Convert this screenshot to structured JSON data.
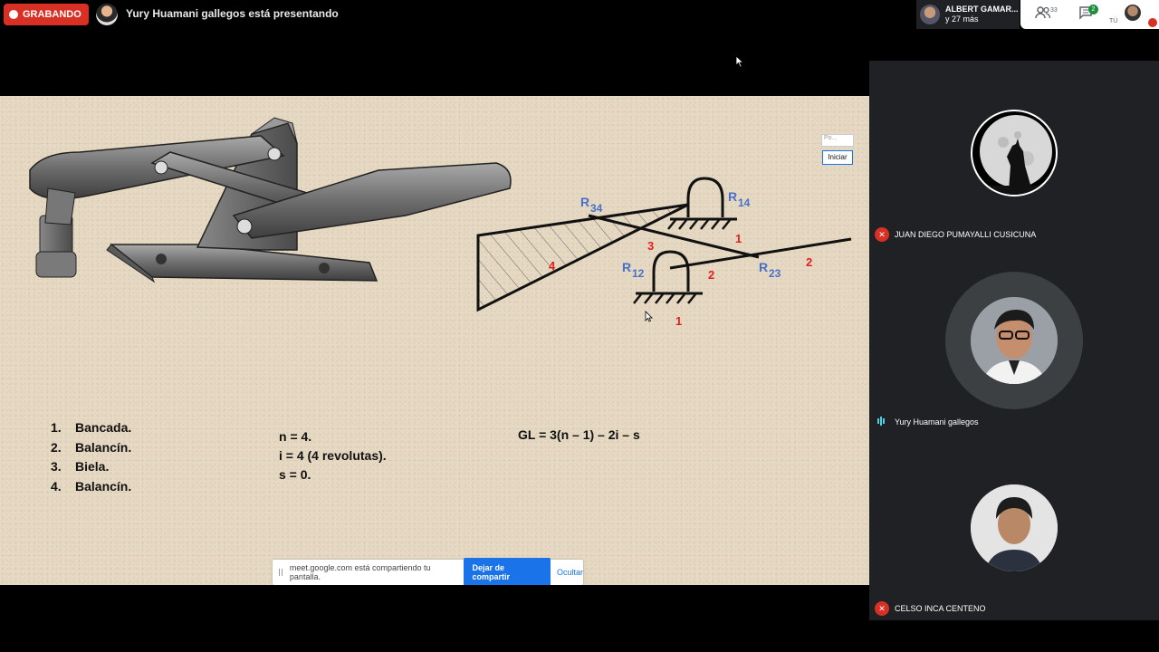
{
  "topbar": {
    "recording_label": "GRABANDO",
    "presenting_text": "Yury Huamani gallegos está presentando",
    "participants_chip": {
      "name": "ALBERT GAMAR...",
      "more": "y 27 más"
    },
    "participants_count": "33",
    "chat_count": "2",
    "self_label": "TÚ"
  },
  "slide": {
    "labels": {
      "r34": "R",
      "r34_sub": "34",
      "r14": "R",
      "r14_sub": "14",
      "r12": "R",
      "r12_sub": "12",
      "r23": "R",
      "r23_sub": "23",
      "n1a": "1",
      "n1b": "1",
      "n2a": "2",
      "n2b": "2",
      "n3": "3",
      "n4": "4"
    },
    "list": [
      {
        "num": "1.",
        "text": "Bancada."
      },
      {
        "num": "2.",
        "text": "Balancín."
      },
      {
        "num": "3.",
        "text": "Biela."
      },
      {
        "num": "4.",
        "text": "Balancín."
      }
    ],
    "params": [
      "n = 4.",
      "i = 4 (4 revolutas).",
      "s = 0."
    ],
    "formula": "GL = 3(n – 1) – 2i – s",
    "mini_placeholder": "Po...",
    "mini_button": "Iniciar"
  },
  "share_bar": {
    "text": "meet.google.com está compartiendo tu pantalla.",
    "stop_label": "Dejar de compartir",
    "hide_label": "Ocultar"
  },
  "participants": [
    {
      "name": "JUAN DIEGO PUMAYALLI CUSICUNA",
      "muted": true
    },
    {
      "name": "Yury Huamani gallegos",
      "muted": false,
      "speaking": true
    },
    {
      "name": "CELSO INCA CENTENO",
      "muted": true
    }
  ],
  "colors": {
    "record_red": "#d93025",
    "accent_blue": "#1a73e8",
    "label_blue": "#4a6fc9",
    "label_red": "#e02020",
    "panel_bg": "#202124"
  }
}
